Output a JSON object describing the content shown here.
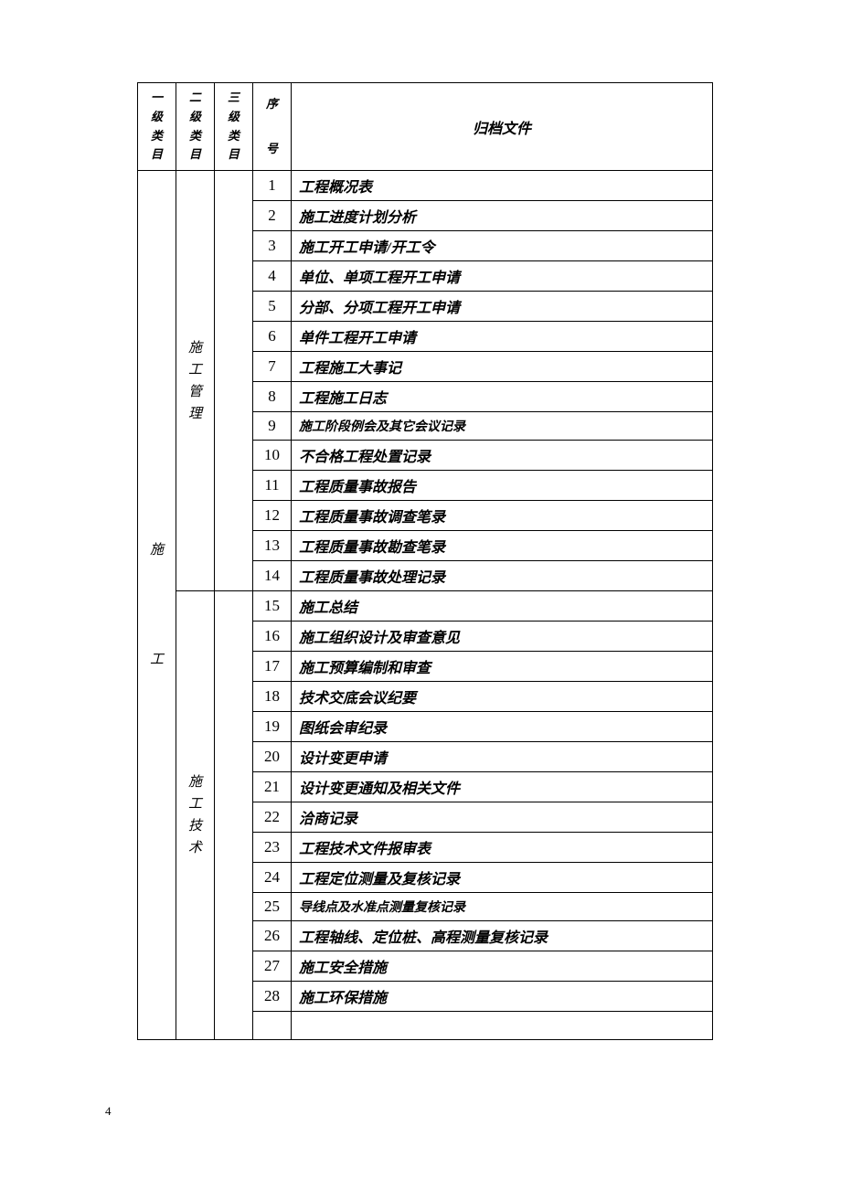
{
  "headers": {
    "l1": "一级类目",
    "l2": "二级类目",
    "l3": "三级类目",
    "seq_top": "序",
    "seq_bottom": "号",
    "file": "归档文件"
  },
  "level1": "施工",
  "groups": [
    {
      "l2": "施工管理",
      "rows": [
        {
          "seq": "1",
          "file": "工程概况表"
        },
        {
          "seq": "2",
          "file": "施工进度计划分析"
        },
        {
          "seq": "3",
          "file": "施工开工申请/开工令"
        },
        {
          "seq": "4",
          "file": "单位、单项工程开工申请"
        },
        {
          "seq": "5",
          "file": "分部、分项工程开工申请"
        },
        {
          "seq": "6",
          "file": "单件工程开工申请"
        },
        {
          "seq": "7",
          "file": "工程施工大事记"
        },
        {
          "seq": "8",
          "file": "工程施工日志"
        },
        {
          "seq": "9",
          "file": "施工阶段例会及其它会议记录",
          "small": true
        },
        {
          "seq": "10",
          "file": "不合格工程处置记录"
        },
        {
          "seq": "11",
          "file": "工程质量事故报告"
        },
        {
          "seq": "12",
          "file": "工程质量事故调查笔录"
        },
        {
          "seq": "13",
          "file": "工程质量事故勘查笔录"
        },
        {
          "seq": "14",
          "file": "工程质量事故处理记录"
        }
      ]
    },
    {
      "l2": "施工技术",
      "rows": [
        {
          "seq": "15",
          "file": "施工总结"
        },
        {
          "seq": "16",
          "file": "施工组织设计及审查意见"
        },
        {
          "seq": "17",
          "file": "施工预算编制和审查"
        },
        {
          "seq": "18",
          "file": "技术交底会议纪要"
        },
        {
          "seq": "19",
          "file": "图纸会审纪录"
        },
        {
          "seq": "20",
          "file": "设计变更申请"
        },
        {
          "seq": "21",
          "file": "设计变更通知及相关文件"
        },
        {
          "seq": "22",
          "file": "洽商记录"
        },
        {
          "seq": "23",
          "file": "工程技术文件报审表"
        },
        {
          "seq": "24",
          "file": "工程定位测量及复核记录"
        },
        {
          "seq": "25",
          "file": "导线点及水准点测量复核记录",
          "small": true
        },
        {
          "seq": "26",
          "file": "工程轴线、定位桩、高程测量复核记录"
        },
        {
          "seq": "27",
          "file": "施工安全措施"
        },
        {
          "seq": "28",
          "file": "施工环保措施"
        }
      ]
    }
  ],
  "page_number": "4"
}
